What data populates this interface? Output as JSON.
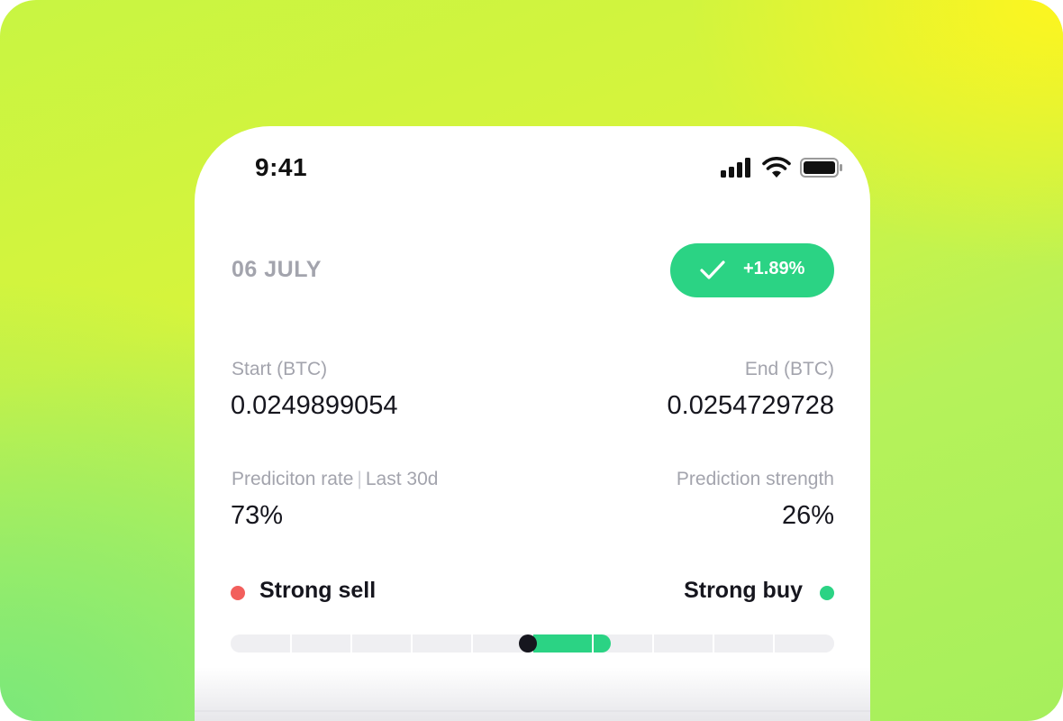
{
  "status_bar": {
    "time": "9:41",
    "icons": [
      "cellular-signal-icon",
      "wifi-icon",
      "battery-icon"
    ]
  },
  "card": {
    "date": "06 JULY",
    "change_badge": {
      "icon": "checkmark-icon",
      "value": "+1.89%",
      "color": "#2bd384"
    },
    "start": {
      "label": "Start (BTC)",
      "value": "0.0249899054"
    },
    "end": {
      "label": "End (BTC)",
      "value": "0.0254729728"
    },
    "prediction_rate": {
      "label": "Prediciton rate",
      "separator": "|",
      "period": "Last 30d",
      "value": "73%"
    },
    "prediction_strength": {
      "label": "Prediction strength",
      "value": "26%"
    },
    "legend": {
      "sell_label": "Strong sell",
      "sell_color": "#f25f5c",
      "buy_label": "Strong buy",
      "buy_color": "#2bd384"
    },
    "strength_meter": {
      "segments": 10,
      "start_fraction": 0.5,
      "end_fraction": 0.63,
      "fill_color": "#2bd384"
    }
  }
}
